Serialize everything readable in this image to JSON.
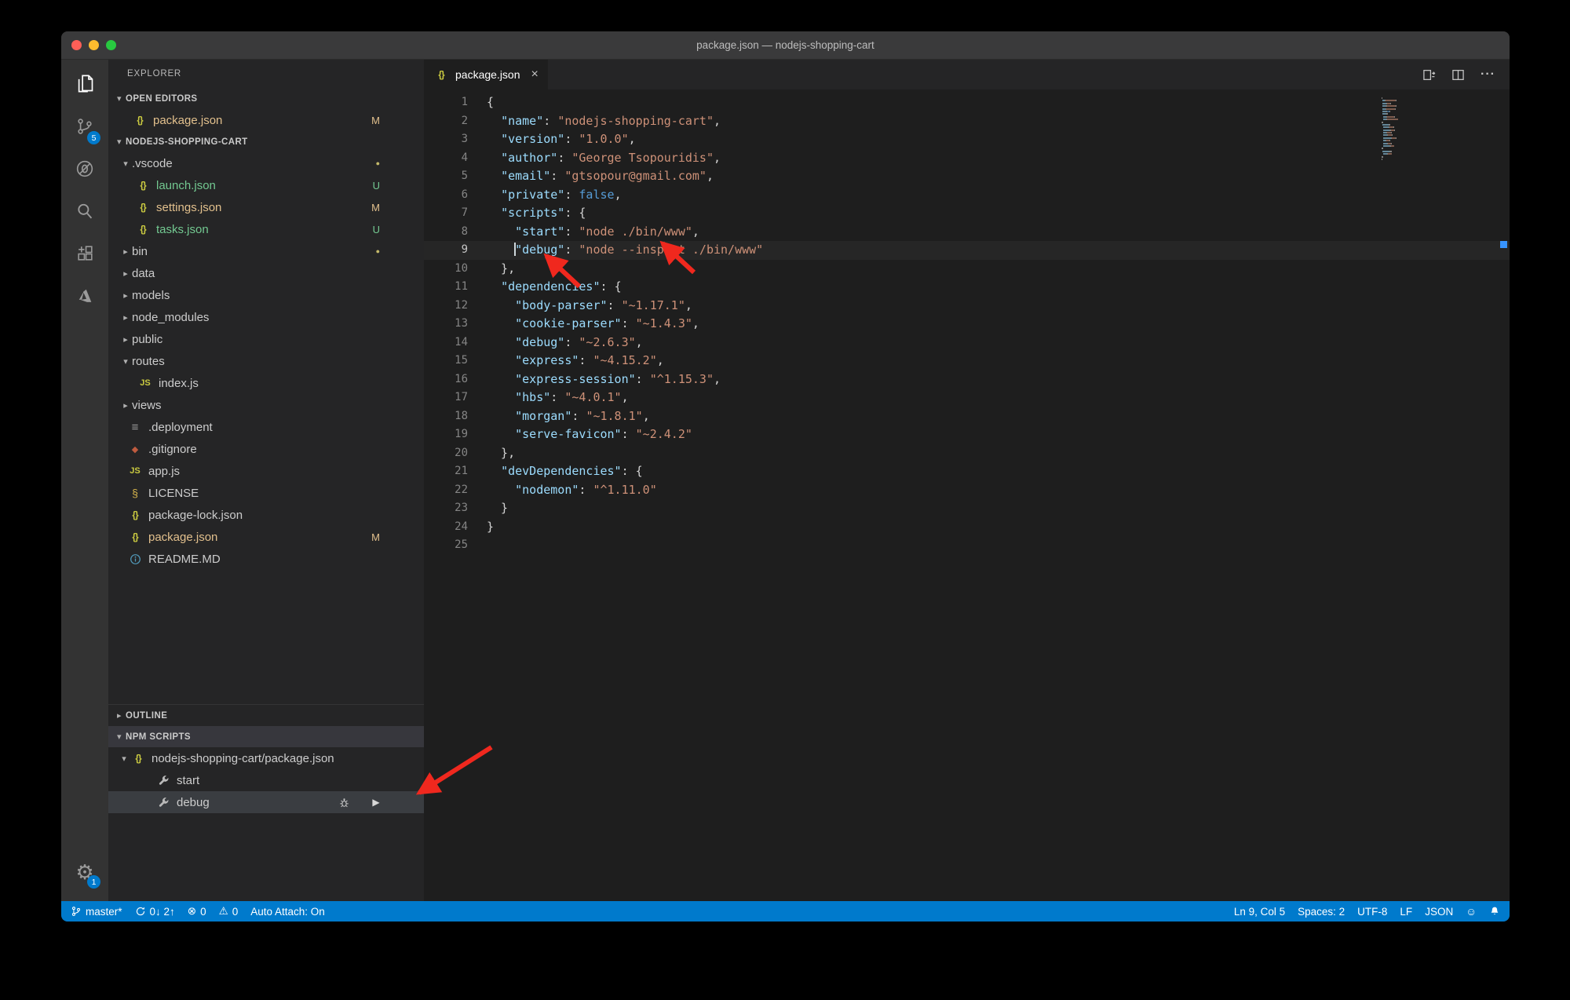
{
  "window": {
    "title": "package.json — nodejs-shopping-cart"
  },
  "traffic_lights": {
    "close": "#ff5f57",
    "minimize": "#febc2e",
    "zoom": "#28c840"
  },
  "activity_bar": {
    "items": [
      {
        "name": "explorer",
        "active": true
      },
      {
        "name": "source-control",
        "badge": "5"
      },
      {
        "name": "debug"
      },
      {
        "name": "search"
      },
      {
        "name": "extensions"
      },
      {
        "name": "azure"
      }
    ],
    "bottom": {
      "name": "manage",
      "badge": "1"
    }
  },
  "sidebar": {
    "title": "EXPLORER",
    "open_editors": {
      "header": "OPEN EDITORS",
      "items": [
        {
          "icon": "json",
          "label": "package.json",
          "badge": "M",
          "state": "mod",
          "pad": 30
        }
      ]
    },
    "tree": {
      "header": "NODEJS-SHOPPING-CART",
      "items": [
        {
          "kind": "folder",
          "label": ".vscode",
          "chevron": "open",
          "pad": 14,
          "badge": "●",
          "badge_kind": "dot"
        },
        {
          "kind": "file",
          "icon": "json",
          "label": "launch.json",
          "pad": 34,
          "badge": "U",
          "state": "unt"
        },
        {
          "kind": "file",
          "icon": "json",
          "label": "settings.json",
          "pad": 34,
          "badge": "M",
          "state": "mod"
        },
        {
          "kind": "file",
          "icon": "json",
          "label": "tasks.json",
          "pad": 34,
          "badge": "U",
          "state": "unt"
        },
        {
          "kind": "folder",
          "label": "bin",
          "chevron": "closed",
          "pad": 14,
          "badge": "●",
          "badge_kind": "dot"
        },
        {
          "kind": "folder",
          "label": "data",
          "chevron": "closed",
          "pad": 14
        },
        {
          "kind": "folder",
          "label": "models",
          "chevron": "closed",
          "pad": 14
        },
        {
          "kind": "folder",
          "label": "node_modules",
          "chevron": "closed",
          "pad": 14
        },
        {
          "kind": "folder",
          "label": "public",
          "chevron": "closed",
          "pad": 14
        },
        {
          "kind": "folder",
          "label": "routes",
          "chevron": "open",
          "pad": 14
        },
        {
          "kind": "file",
          "icon": "js",
          "label": "index.js",
          "pad": 37
        },
        {
          "kind": "folder",
          "label": "views",
          "chevron": "closed",
          "pad": 14
        },
        {
          "kind": "file",
          "icon": "deployment",
          "label": ".deployment",
          "pad": 24
        },
        {
          "kind": "file",
          "icon": "gitignore",
          "label": ".gitignore",
          "pad": 24
        },
        {
          "kind": "file",
          "icon": "js",
          "label": "app.js",
          "pad": 24
        },
        {
          "kind": "file",
          "icon": "license",
          "label": "LICENSE",
          "pad": 24
        },
        {
          "kind": "file",
          "icon": "json",
          "label": "package-lock.json",
          "pad": 24
        },
        {
          "kind": "file",
          "icon": "json",
          "label": "package.json",
          "pad": 24,
          "badge": "M",
          "state": "mod"
        },
        {
          "kind": "file",
          "icon": "info",
          "label": "README.MD",
          "pad": 24
        }
      ]
    },
    "outline": {
      "header": "OUTLINE",
      "chevron": "closed"
    },
    "npm_scripts": {
      "header": "NPM SCRIPTS",
      "items": [
        {
          "icon": "json",
          "label": "nodejs-shopping-cart/package.json",
          "chevron": "open",
          "pad": 12
        },
        {
          "icon": "wrench",
          "label": "start",
          "pad": 60
        },
        {
          "icon": "wrench",
          "label": "debug",
          "pad": 60,
          "selected": true,
          "actions": [
            "bug",
            "run"
          ]
        }
      ]
    }
  },
  "editor": {
    "tab": {
      "icon": "json",
      "label": "package.json",
      "close": "×"
    },
    "actions": [
      {
        "name": "open-changes"
      },
      {
        "name": "split-editor"
      },
      {
        "name": "more-actions"
      }
    ],
    "cursor_line": 9,
    "lines": [
      {
        "n": 1,
        "t": [
          [
            "p",
            "{"
          ]
        ]
      },
      {
        "n": 2,
        "t": [
          [
            "p",
            "  "
          ],
          [
            "k",
            "\"name\""
          ],
          [
            "p",
            ": "
          ],
          [
            "s",
            "\"nodejs-shopping-cart\""
          ],
          [
            "p",
            ","
          ]
        ]
      },
      {
        "n": 3,
        "t": [
          [
            "p",
            "  "
          ],
          [
            "k",
            "\"version\""
          ],
          [
            "p",
            ": "
          ],
          [
            "s",
            "\"1.0.0\""
          ],
          [
            "p",
            ","
          ]
        ]
      },
      {
        "n": 4,
        "t": [
          [
            "p",
            "  "
          ],
          [
            "k",
            "\"author\""
          ],
          [
            "p",
            ": "
          ],
          [
            "s",
            "\"George Tsopouridis\""
          ],
          [
            "p",
            ","
          ]
        ]
      },
      {
        "n": 5,
        "t": [
          [
            "p",
            "  "
          ],
          [
            "k",
            "\"email\""
          ],
          [
            "p",
            ": "
          ],
          [
            "s",
            "\"gtsopour@gmail.com\""
          ],
          [
            "p",
            ","
          ]
        ]
      },
      {
        "n": 6,
        "t": [
          [
            "p",
            "  "
          ],
          [
            "k",
            "\"private\""
          ],
          [
            "p",
            ": "
          ],
          [
            "b",
            "false"
          ],
          [
            "p",
            ","
          ]
        ]
      },
      {
        "n": 7,
        "t": [
          [
            "p",
            "  "
          ],
          [
            "k",
            "\"scripts\""
          ],
          [
            "p",
            ": "
          ],
          [
            "p",
            "{"
          ]
        ]
      },
      {
        "n": 8,
        "t": [
          [
            "p",
            "    "
          ],
          [
            "k",
            "\"start\""
          ],
          [
            "p",
            ": "
          ],
          [
            "s",
            "\"node ./bin/www\""
          ],
          [
            "p",
            ","
          ]
        ]
      },
      {
        "n": 9,
        "t": [
          [
            "p",
            "    "
          ],
          [
            "k",
            "\"debug\""
          ],
          [
            "p",
            ": "
          ],
          [
            "s",
            "\"node --inspect ./bin/www\""
          ]
        ]
      },
      {
        "n": 10,
        "t": [
          [
            "p",
            "  },"
          ]
        ]
      },
      {
        "n": 11,
        "t": [
          [
            "p",
            "  "
          ],
          [
            "k",
            "\"dependencies\""
          ],
          [
            "p",
            ": "
          ],
          [
            "p",
            "{"
          ]
        ]
      },
      {
        "n": 12,
        "t": [
          [
            "p",
            "    "
          ],
          [
            "k",
            "\"body-parser\""
          ],
          [
            "p",
            ": "
          ],
          [
            "s",
            "\"~1.17.1\""
          ],
          [
            "p",
            ","
          ]
        ]
      },
      {
        "n": 13,
        "t": [
          [
            "p",
            "    "
          ],
          [
            "k",
            "\"cookie-parser\""
          ],
          [
            "p",
            ": "
          ],
          [
            "s",
            "\"~1.4.3\""
          ],
          [
            "p",
            ","
          ]
        ]
      },
      {
        "n": 14,
        "t": [
          [
            "p",
            "    "
          ],
          [
            "k",
            "\"debug\""
          ],
          [
            "p",
            ": "
          ],
          [
            "s",
            "\"~2.6.3\""
          ],
          [
            "p",
            ","
          ]
        ]
      },
      {
        "n": 15,
        "t": [
          [
            "p",
            "    "
          ],
          [
            "k",
            "\"express\""
          ],
          [
            "p",
            ": "
          ],
          [
            "s",
            "\"~4.15.2\""
          ],
          [
            "p",
            ","
          ]
        ]
      },
      {
        "n": 16,
        "t": [
          [
            "p",
            "    "
          ],
          [
            "k",
            "\"express-session\""
          ],
          [
            "p",
            ": "
          ],
          [
            "s",
            "\"^1.15.3\""
          ],
          [
            "p",
            ","
          ]
        ]
      },
      {
        "n": 17,
        "t": [
          [
            "p",
            "    "
          ],
          [
            "k",
            "\"hbs\""
          ],
          [
            "p",
            ": "
          ],
          [
            "s",
            "\"~4.0.1\""
          ],
          [
            "p",
            ","
          ]
        ]
      },
      {
        "n": 18,
        "t": [
          [
            "p",
            "    "
          ],
          [
            "k",
            "\"morgan\""
          ],
          [
            "p",
            ": "
          ],
          [
            "s",
            "\"~1.8.1\""
          ],
          [
            "p",
            ","
          ]
        ]
      },
      {
        "n": 19,
        "t": [
          [
            "p",
            "    "
          ],
          [
            "k",
            "\"serve-favicon\""
          ],
          [
            "p",
            ": "
          ],
          [
            "s",
            "\"~2.4.2\""
          ]
        ]
      },
      {
        "n": 20,
        "t": [
          [
            "p",
            "  },"
          ]
        ]
      },
      {
        "n": 21,
        "t": [
          [
            "p",
            "  "
          ],
          [
            "k",
            "\"devDependencies\""
          ],
          [
            "p",
            ": "
          ],
          [
            "p",
            "{"
          ]
        ]
      },
      {
        "n": 22,
        "t": [
          [
            "p",
            "    "
          ],
          [
            "k",
            "\"nodemon\""
          ],
          [
            "p",
            ": "
          ],
          [
            "s",
            "\"^1.11.0\""
          ]
        ]
      },
      {
        "n": 23,
        "t": [
          [
            "p",
            "  }"
          ]
        ]
      },
      {
        "n": 24,
        "t": [
          [
            "p",
            "}"
          ]
        ]
      },
      {
        "n": 25,
        "t": []
      }
    ]
  },
  "status_bar": {
    "left": [
      {
        "icon": "branch",
        "label": "master*"
      },
      {
        "icon": "sync",
        "label": "0↓ 2↑"
      },
      {
        "icon": "error",
        "label": "0"
      },
      {
        "icon": "warning",
        "label": "0"
      },
      {
        "label": "Auto Attach: On"
      }
    ],
    "right": [
      {
        "label": "Ln 9, Col 5"
      },
      {
        "label": "Spaces: 2"
      },
      {
        "label": "UTF-8"
      },
      {
        "label": "LF"
      },
      {
        "label": "JSON"
      },
      {
        "icon": "smiley"
      },
      {
        "icon": "bell"
      }
    ]
  },
  "colors": {
    "accent": "#007acc",
    "modified": "#e2c08d",
    "untracked": "#73c991",
    "key": "#9cdcfe",
    "string": "#ce9178",
    "keyword": "#569cd6",
    "arrow": "#f0281e"
  }
}
